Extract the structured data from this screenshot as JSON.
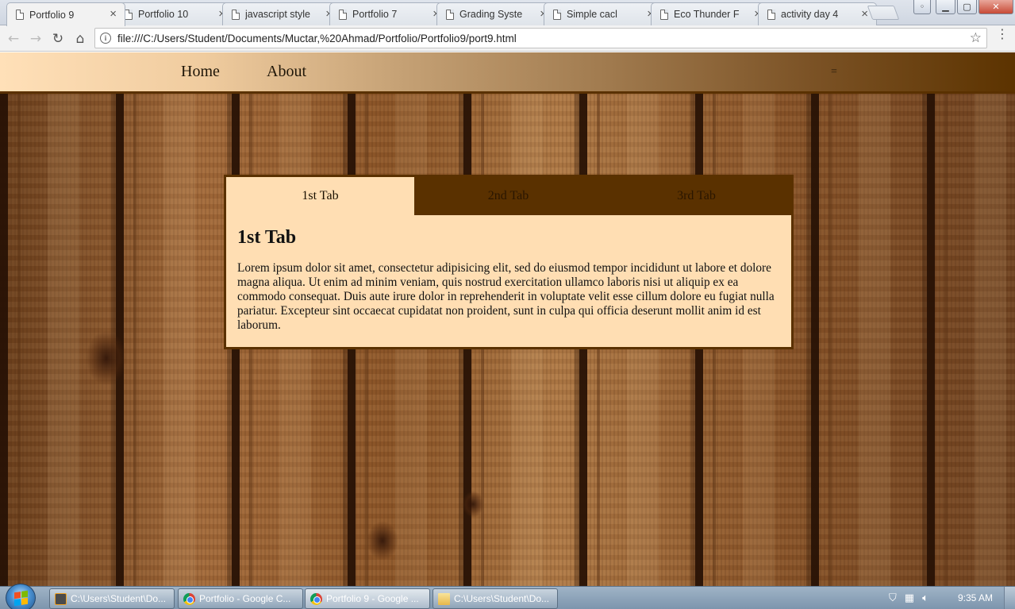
{
  "browser": {
    "tabs": [
      {
        "label": "Portfolio 9",
        "active": true
      },
      {
        "label": "Portfolio 10",
        "active": false
      },
      {
        "label": "javascript style",
        "active": false
      },
      {
        "label": "Portfolio 7",
        "active": false
      },
      {
        "label": "Grading Syste",
        "active": false
      },
      {
        "label": "Simple cacl",
        "active": false
      },
      {
        "label": "Eco Thunder F",
        "active": false
      },
      {
        "label": "activity day 4",
        "active": false
      }
    ],
    "url": "file:///C:/Users/Student/Documents/Muctar,%20Ahmad/Portfolio/Portfolio9/port9.html",
    "icons": {
      "back": "←",
      "forward": "→",
      "reload": "↻",
      "home": "⌂",
      "star": "☆",
      "menu": "⋮",
      "close_tab": "×",
      "info": "i",
      "minimize": "▭",
      "maximize": "▢",
      "close_window": "✕",
      "user": "👤"
    }
  },
  "site": {
    "nav": {
      "home": "Home",
      "about": "About",
      "menu_toggle": "="
    },
    "tabs": [
      {
        "label": "1st Tab",
        "active": true
      },
      {
        "label": "2nd Tab",
        "active": false
      },
      {
        "label": "3rd Tab",
        "active": false
      }
    ],
    "content": {
      "heading": "1st Tab",
      "body": "Lorem ipsum dolor sit amet, consectetur adipisicing elit, sed do eiusmod tempor incididunt ut labore et dolore magna aliqua. Ut enim ad minim veniam, quis nostrud exercitation ullamco laboris nisi ut aliquip ex ea commodo consequat. Duis aute irure dolor in reprehenderit in voluptate velit esse cillum dolore eu fugiat nulla pariatur. Excepteur sint occaecat cupidatat non proident, sunt in culpa qui officia deserunt mollit anim id est laborum."
    },
    "colors": {
      "tab_active": "#ffdeb3",
      "tab_bar": "#5a3100",
      "nav_start": "#ffe0b8",
      "nav_end": "#5c3300"
    }
  },
  "taskbar": {
    "items": [
      {
        "label": "C:\\Users\\Student\\Do...",
        "icon": "sublime-icon"
      },
      {
        "label": "Portfolio - Google C...",
        "icon": "chrome-icon"
      },
      {
        "label": "Portfolio 9 - Google ...",
        "icon": "chrome-icon"
      },
      {
        "label": "C:\\Users\\Student\\Do...",
        "icon": "folder-icon"
      }
    ],
    "clock": "9:35 AM",
    "tray_icons": [
      "shield-icon",
      "network-icon",
      "volume-icon"
    ]
  }
}
